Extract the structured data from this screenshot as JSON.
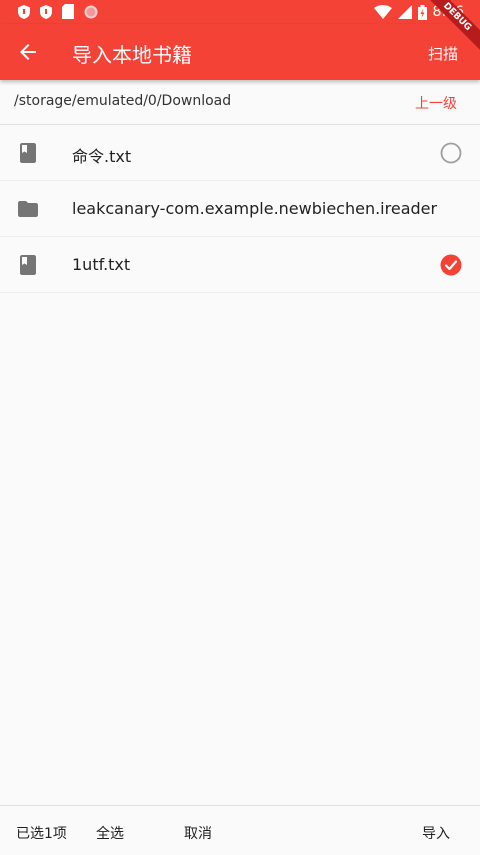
{
  "status_bar": {
    "time": "8:46",
    "icons": [
      "shield-icon",
      "shield-icon",
      "sd-card-icon",
      "record-icon",
      "wifi-icon",
      "signal-icon",
      "battery-icon"
    ]
  },
  "debug_banner": "DEBUG",
  "app_bar": {
    "back_icon": "arrow-back-icon",
    "title": "导入本地书籍",
    "scan_label": "扫描"
  },
  "path_bar": {
    "path": "/storage/emulated/0/Download",
    "up_label": "上一级"
  },
  "files": [
    {
      "name": "命令.txt",
      "type": "file",
      "icon": "book-icon",
      "selectable": true,
      "selected": false
    },
    {
      "name": "leakcanary-com.example.newbiechen.ireader",
      "type": "folder",
      "icon": "folder-icon",
      "selectable": false,
      "selected": false
    },
    {
      "name": "1utf.txt",
      "type": "file",
      "icon": "book-icon",
      "selectable": true,
      "selected": true
    }
  ],
  "bottom_bar": {
    "selected_count": "已选1项",
    "select_all": "全选",
    "cancel": "取消",
    "import": "导入"
  },
  "colors": {
    "primary": "#f44336",
    "icon_grey": "#757575",
    "check_red": "#f44336"
  }
}
